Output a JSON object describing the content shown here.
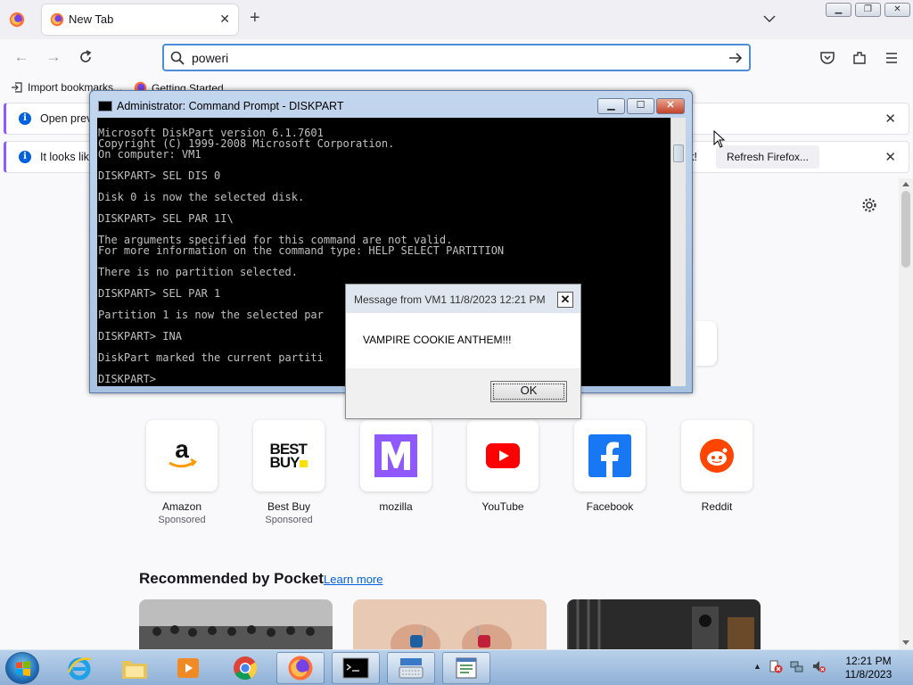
{
  "browser": {
    "tab": {
      "title": "New Tab"
    },
    "url_value": "poweri",
    "bookmarks": [
      "Import bookmarks...",
      "Getting Started"
    ],
    "notifications": [
      {
        "text": "Open previ",
        "tail": "",
        "button": ""
      },
      {
        "text": "It looks like",
        "tail": "k!",
        "button": "Refresh Firefox..."
      }
    ]
  },
  "top_sites": [
    {
      "label": "Amazon",
      "sub": "Sponsored",
      "icon": "amazon-logo"
    },
    {
      "label": "Best Buy",
      "sub": "Sponsored",
      "icon": "best-buy-logo"
    },
    {
      "label": "mozilla",
      "sub": "",
      "icon": "mozilla-logo"
    },
    {
      "label": "YouTube",
      "sub": "",
      "icon": "youtube-logo"
    },
    {
      "label": "Facebook",
      "sub": "",
      "icon": "facebook-logo"
    },
    {
      "label": "Reddit",
      "sub": "",
      "icon": "reddit-logo"
    }
  ],
  "bestbuy_logo_text": [
    "BEST",
    "BUY"
  ],
  "pocket": {
    "title": "Recommended by Pocket",
    "link": "Learn more"
  },
  "cmd": {
    "title": "Administrator:  Command Prompt - DISKPART",
    "lines": [
      "Microsoft DiskPart version 6.1.7601",
      "Copyright (C) 1999-2008 Microsoft Corporation.",
      "On computer: VM1",
      "",
      "DISKPART> SEL DIS 0",
      "",
      "Disk 0 is now the selected disk.",
      "",
      "DISKPART> SEL PAR 1I\\",
      "",
      "The arguments specified for this command are not valid.",
      "For more information on the command type: HELP SELECT PARTITION",
      "",
      "There is no partition selected.",
      "",
      "DISKPART> SEL PAR 1",
      "",
      "Partition 1 is now the selected par",
      "",
      "DISKPART> INA",
      "",
      "DiskPart marked the current partiti",
      "",
      "DISKPART>"
    ]
  },
  "message_box": {
    "title": "Message from VM1 11/8/2023 12:21 PM",
    "text": "VAMPIRE COOKIE ANTHEM!!!",
    "ok_label": "OK"
  },
  "taskbar": {
    "apps": [
      "internet-explorer",
      "file-explorer",
      "media-player",
      "chrome",
      "firefox",
      "command-prompt",
      "keyboard-app",
      "notepad-app"
    ],
    "time": "12:21 PM",
    "date": "11/8/2023"
  },
  "colors": {
    "accent": "#0060df",
    "notification_bar": "#9059ff",
    "youtube": "#ff0000",
    "facebook": "#1877f2",
    "reddit": "#ff4500",
    "mozilla": "#9059ff"
  }
}
